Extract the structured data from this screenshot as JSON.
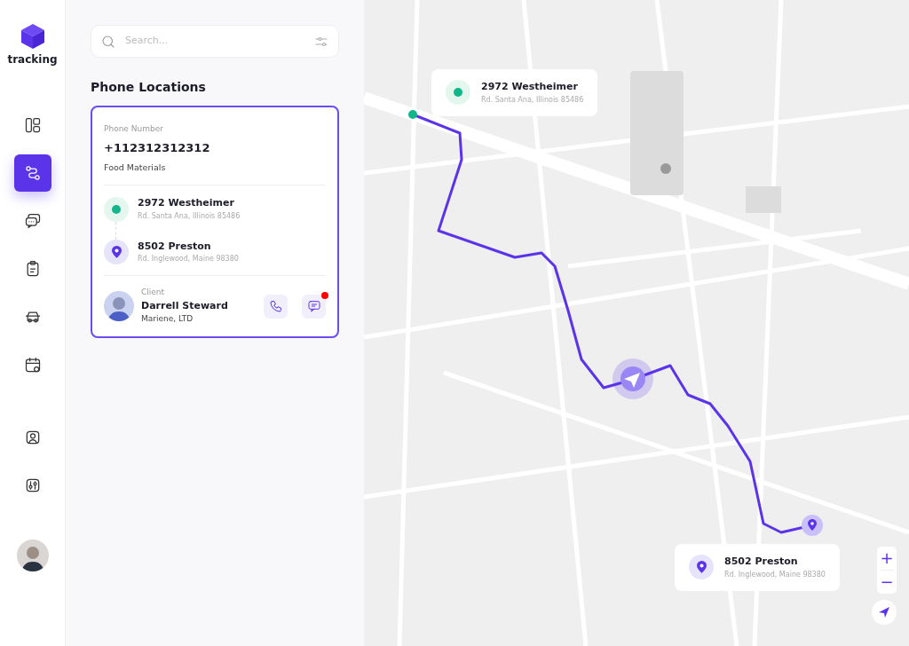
{
  "logo": {
    "text": "tracking"
  },
  "nav_main": [
    {
      "selected": false
    },
    {
      "selected": true
    },
    {
      "selected": false
    },
    {
      "selected": false
    },
    {
      "selected": false
    },
    {
      "selected": false
    }
  ],
  "nav_secondary": [
    {
      "selected": false
    },
    {
      "selected": false
    }
  ],
  "search": {
    "placeholder": "Search..."
  },
  "section_title": "Phone Locations",
  "shipment_card": {
    "phone_label": "Phone Number",
    "phone": "+112312312312",
    "category": "Food Materials",
    "stops": [
      {
        "kind": "origin",
        "name": "2972 Westheimer",
        "address": "Rd. Santa Ana, Illinois 85486"
      },
      {
        "kind": "destination",
        "name": "8502 Preston",
        "address": "Rd. Inglewood, Maine 98380"
      }
    ],
    "client": {
      "label": "Client",
      "name": "Darrell Steward",
      "company": "Mariene, LTD",
      "unread_message": true
    }
  },
  "map": {
    "callouts": [
      {
        "kind": "origin",
        "name": "2972 Westheimer",
        "address": "Rd. Santa Ana, Illinois 85486"
      },
      {
        "kind": "destination",
        "name": "8502 Preston",
        "address": "Rd. Inglewood, Maine 98380"
      }
    ],
    "zoom_in": "+",
    "zoom_out": "−"
  }
}
